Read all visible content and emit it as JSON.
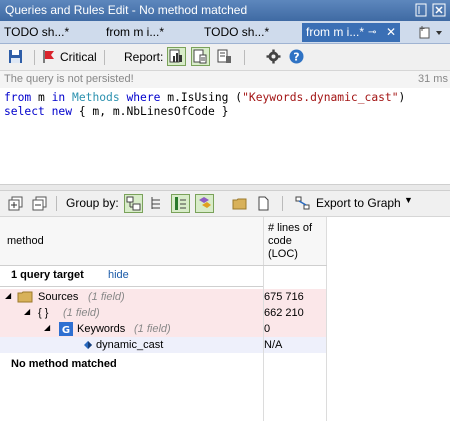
{
  "title_bar": {
    "title": "Queries and Rules Edit  - No method matched",
    "pin_icon": "pin-icon",
    "close_icon": "close-icon"
  },
  "tabs": [
    {
      "label": "TODO sh...*",
      "selected": false
    },
    {
      "label": "from m i...*",
      "selected": false
    },
    {
      "label": "TODO sh...*",
      "selected": false
    },
    {
      "label": "from m i...*",
      "selected": true
    }
  ],
  "toolbar": {
    "critical_label": "Critical",
    "report_label": "Report:"
  },
  "status": {
    "message": "The query is not persisted!",
    "time": "31 ms"
  },
  "editor": {
    "line1": {
      "from": "from",
      "var1": " m ",
      "in": "in",
      "space": " ",
      "methods": "Methods",
      "where": " where",
      "rest1": " m.IsUsing (",
      "str": "\"Keywords.dynamic_cast\"",
      "close": ")"
    },
    "line2": {
      "select": "select",
      "new": " new",
      "rest": " { m, m.NbLinesOfCode }"
    }
  },
  "results_toolbar": {
    "group_by_label": "Group by:",
    "export_label": "Export to Graph"
  },
  "grid": {
    "col_method": "method",
    "col_loc_l1": "# lines of",
    "col_loc_l2": "code",
    "col_loc_l3": "(LOC)",
    "target_label": "1 query target",
    "hide_label": "hide",
    "rows": [
      {
        "name": "Sources",
        "field": "(1 field)",
        "value": "675 716"
      },
      {
        "name": "{ }",
        "field": "(1 field)",
        "value": "662 210"
      },
      {
        "name": "Keywords",
        "field": "(1 field)",
        "value": "0"
      },
      {
        "name": "dynamic_cast",
        "field": "",
        "value": "N/A"
      }
    ],
    "footer": "No method matched"
  },
  "colors": {
    "title_bar": "#4a76b0",
    "selected_tab": "#3a6fb5",
    "keyword": "#0000cc",
    "type": "#2b91af",
    "string": "#a31515",
    "row_highlight": "#fbe7e9"
  }
}
